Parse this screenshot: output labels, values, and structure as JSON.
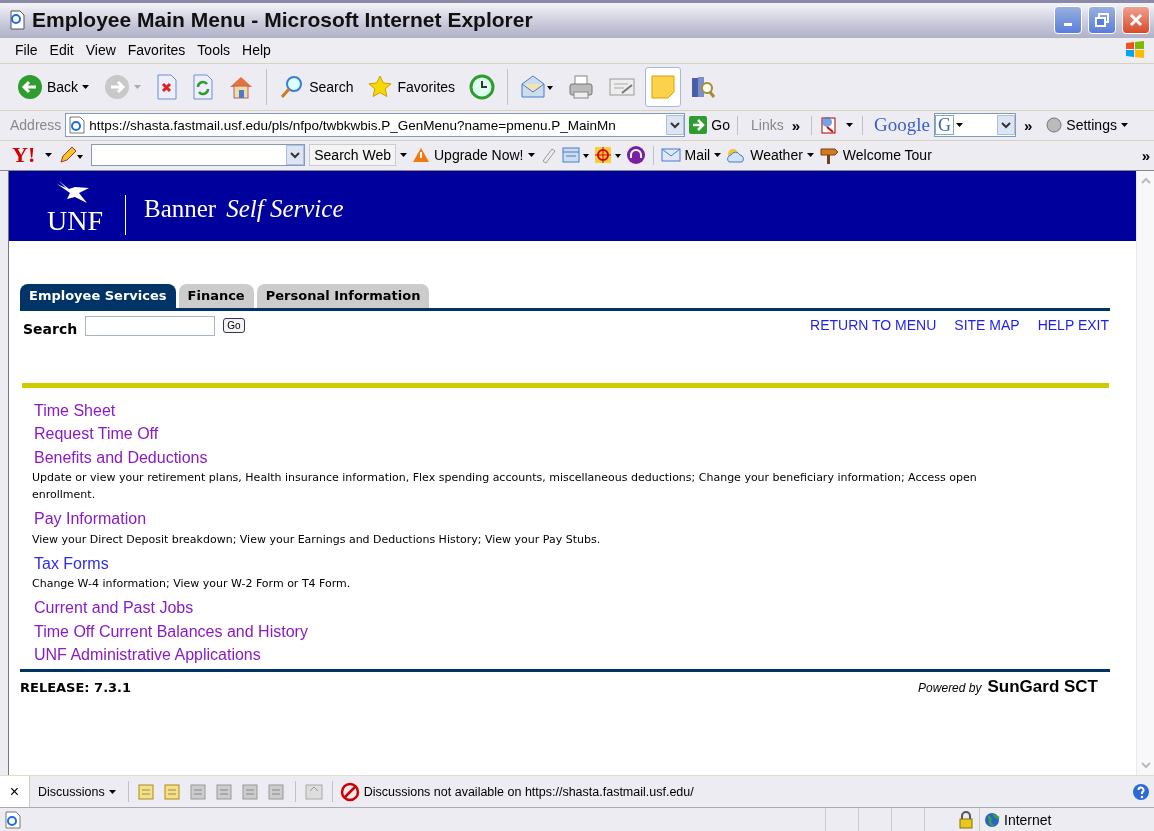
{
  "window": {
    "title": "Employee Main Menu - Microsoft Internet Explorer"
  },
  "menu": [
    "File",
    "Edit",
    "View",
    "Favorites",
    "Tools",
    "Help"
  ],
  "toolbar": [
    {
      "kind": "back",
      "label": "Back",
      "pressed": false
    },
    {
      "kind": "forward",
      "pressed": false
    },
    {
      "kind": "stop",
      "pressed": false
    },
    {
      "kind": "refresh",
      "pressed": false
    },
    {
      "kind": "home",
      "pressed": false
    },
    {
      "kind": "search",
      "label": "Search",
      "pressed": false
    },
    {
      "kind": "favorites",
      "label": "Favorites",
      "pressed": false
    },
    {
      "kind": "history",
      "pressed": false
    },
    {
      "kind": "mail",
      "pressed": false
    },
    {
      "kind": "print",
      "pressed": false
    },
    {
      "kind": "edit",
      "pressed": false
    },
    {
      "kind": "notes",
      "pressed": true
    },
    {
      "kind": "research",
      "pressed": false
    }
  ],
  "address_bar": {
    "label": "Address",
    "url": "https://shasta.fastmail.usf.edu/pls/nfpo/twbkwbis.P_GenMenu?name=pmenu.P_MainMn",
    "go": "Go",
    "links": "Links",
    "links_more": "»",
    "google": "Google",
    "google_box": "G",
    "google_more": "»",
    "settings": "Settings"
  },
  "yahoo_bar": {
    "logo": "Y!",
    "search_button": "Search Web",
    "upgrade": "Upgrade Now!",
    "mail": "Mail",
    "weather": "Weather",
    "tour": "Welcome Tour",
    "more": "»"
  },
  "page": {
    "logo": "UNF",
    "title": "Banner",
    "subtitle": "Self Service",
    "tabs": [
      {
        "label": "Employee Services",
        "selected": true
      },
      {
        "label": "Finance",
        "selected": false
      },
      {
        "label": "Personal Information",
        "selected": false
      }
    ],
    "search": {
      "label": "Search",
      "button": "Go"
    },
    "nav_links": [
      "RETURN TO MENU",
      "SITE MAP",
      "HELP EXIT"
    ],
    "items": [
      {
        "title": "Time Sheet",
        "visited": true
      },
      {
        "title": "Request Time Off",
        "visited": true
      },
      {
        "title": "Benefits and Deductions",
        "visited": true,
        "description": "Update or view your retirement plans, Health insurance information, Flex spending accounts, miscellaneous deductions; Change your beneficiary information; Access open enrollment."
      },
      {
        "title": "Pay Information",
        "visited": true,
        "description": "View your Direct Deposit breakdown; View your Earnings and Deductions History; View your Pay Stubs."
      },
      {
        "title": "Tax Forms",
        "visited": false,
        "description": "Change W-4 information; View your W-2 Form or T4 Form."
      },
      {
        "title": "Current and Past Jobs",
        "visited": true
      },
      {
        "title": "Time Off Current Balances and History",
        "visited": true
      },
      {
        "title": "UNF Administrative Applications",
        "visited": true
      }
    ],
    "release": "RELEASE: 7.3.1",
    "powered_by": "Powered by",
    "brand": "SunGard SCT"
  },
  "discussions": {
    "close": "×",
    "label": "Discussions",
    "message": "Discussions not available on https://shasta.fastmail.usf.edu/"
  },
  "status_bar": {
    "zone": "Internet"
  }
}
